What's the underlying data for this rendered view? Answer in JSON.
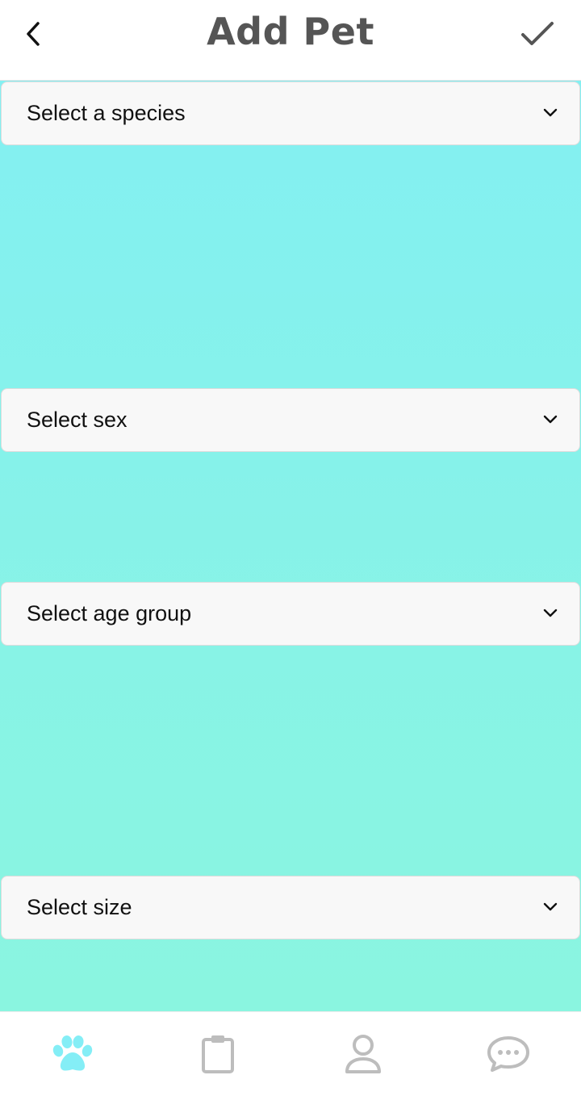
{
  "header": {
    "title": "Add Pet",
    "back_icon": "chevron-left-icon",
    "done_icon": "checkmark-icon"
  },
  "form": {
    "species_placeholder": "Select a species",
    "sex_placeholder": "Select sex",
    "age_placeholder": "Select age group",
    "size_placeholder": "Select size"
  },
  "nav": {
    "tabs": [
      {
        "icon": "paw-icon",
        "active": true
      },
      {
        "icon": "clipboard-icon",
        "active": false
      },
      {
        "icon": "person-icon",
        "active": false
      },
      {
        "icon": "chat-bubble-icon",
        "active": false
      }
    ]
  },
  "colors": {
    "active": "#84eef6",
    "inactive": "#bdbdbd",
    "background_top": "#83f0f2",
    "background_bottom": "#8af5e0"
  }
}
